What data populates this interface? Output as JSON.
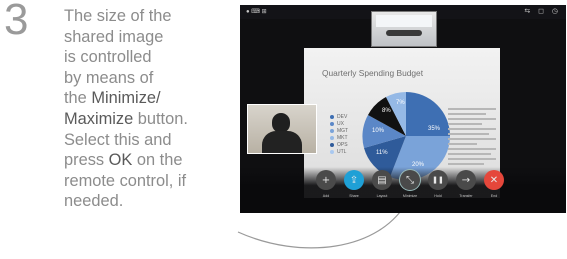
{
  "step": {
    "number": "3"
  },
  "instruction": {
    "lines": [
      "The size of the",
      "shared image",
      "is controlled",
      "by means of",
      "the ",
      "Maximize",
      "Select this and",
      "press ",
      "remote control, if",
      "needed."
    ],
    "bold_minimize": "Minimize/",
    "bold_maximize_tail": " button.",
    "bold_ok": "OK",
    "ok_tail": " on the"
  },
  "screen": {
    "top_left": "● ⌨ ⊞",
    "top_right": "⇆ ◻ ◷",
    "room_caption": "",
    "slide_title": "Quarterly Spending Budget",
    "legend": [
      {
        "label": "DEV",
        "color": "#3e6fb3"
      },
      {
        "label": "UX",
        "color": "#5b87c7"
      },
      {
        "label": "MGT",
        "color": "#7aa3d9"
      },
      {
        "label": "MKT",
        "color": "#95b9e6"
      },
      {
        "label": "OPS",
        "color": "#2f5b9a"
      },
      {
        "label": "UTL",
        "color": "#a9c8ef"
      }
    ],
    "pie_labels": {
      "a": "7%",
      "b": "8%",
      "c": "10%",
      "d": "35%",
      "e": "11%",
      "f": "20%"
    }
  },
  "controls": [
    {
      "icon": "add-icon",
      "glyph": "+",
      "label": "Add",
      "color": "#4a4a4a"
    },
    {
      "icon": "share-icon",
      "glyph": "⇪",
      "label": "Share",
      "color": "#1fa0d6"
    },
    {
      "icon": "layout-icon",
      "glyph": "▤",
      "label": "Layout",
      "color": "#4a4a4a"
    },
    {
      "icon": "minimize-icon",
      "glyph": "⤡",
      "label": "Minimize",
      "color": "#4a4a4a"
    },
    {
      "icon": "hold-icon",
      "glyph": "❚❚",
      "label": "Hold",
      "color": "#4a4a4a"
    },
    {
      "icon": "transfer-icon",
      "glyph": "→",
      "label": "Transfer",
      "color": "#4a4a4a"
    },
    {
      "icon": "end-call-icon",
      "glyph": "✕",
      "label": "End",
      "color": "#e5473b"
    }
  ]
}
